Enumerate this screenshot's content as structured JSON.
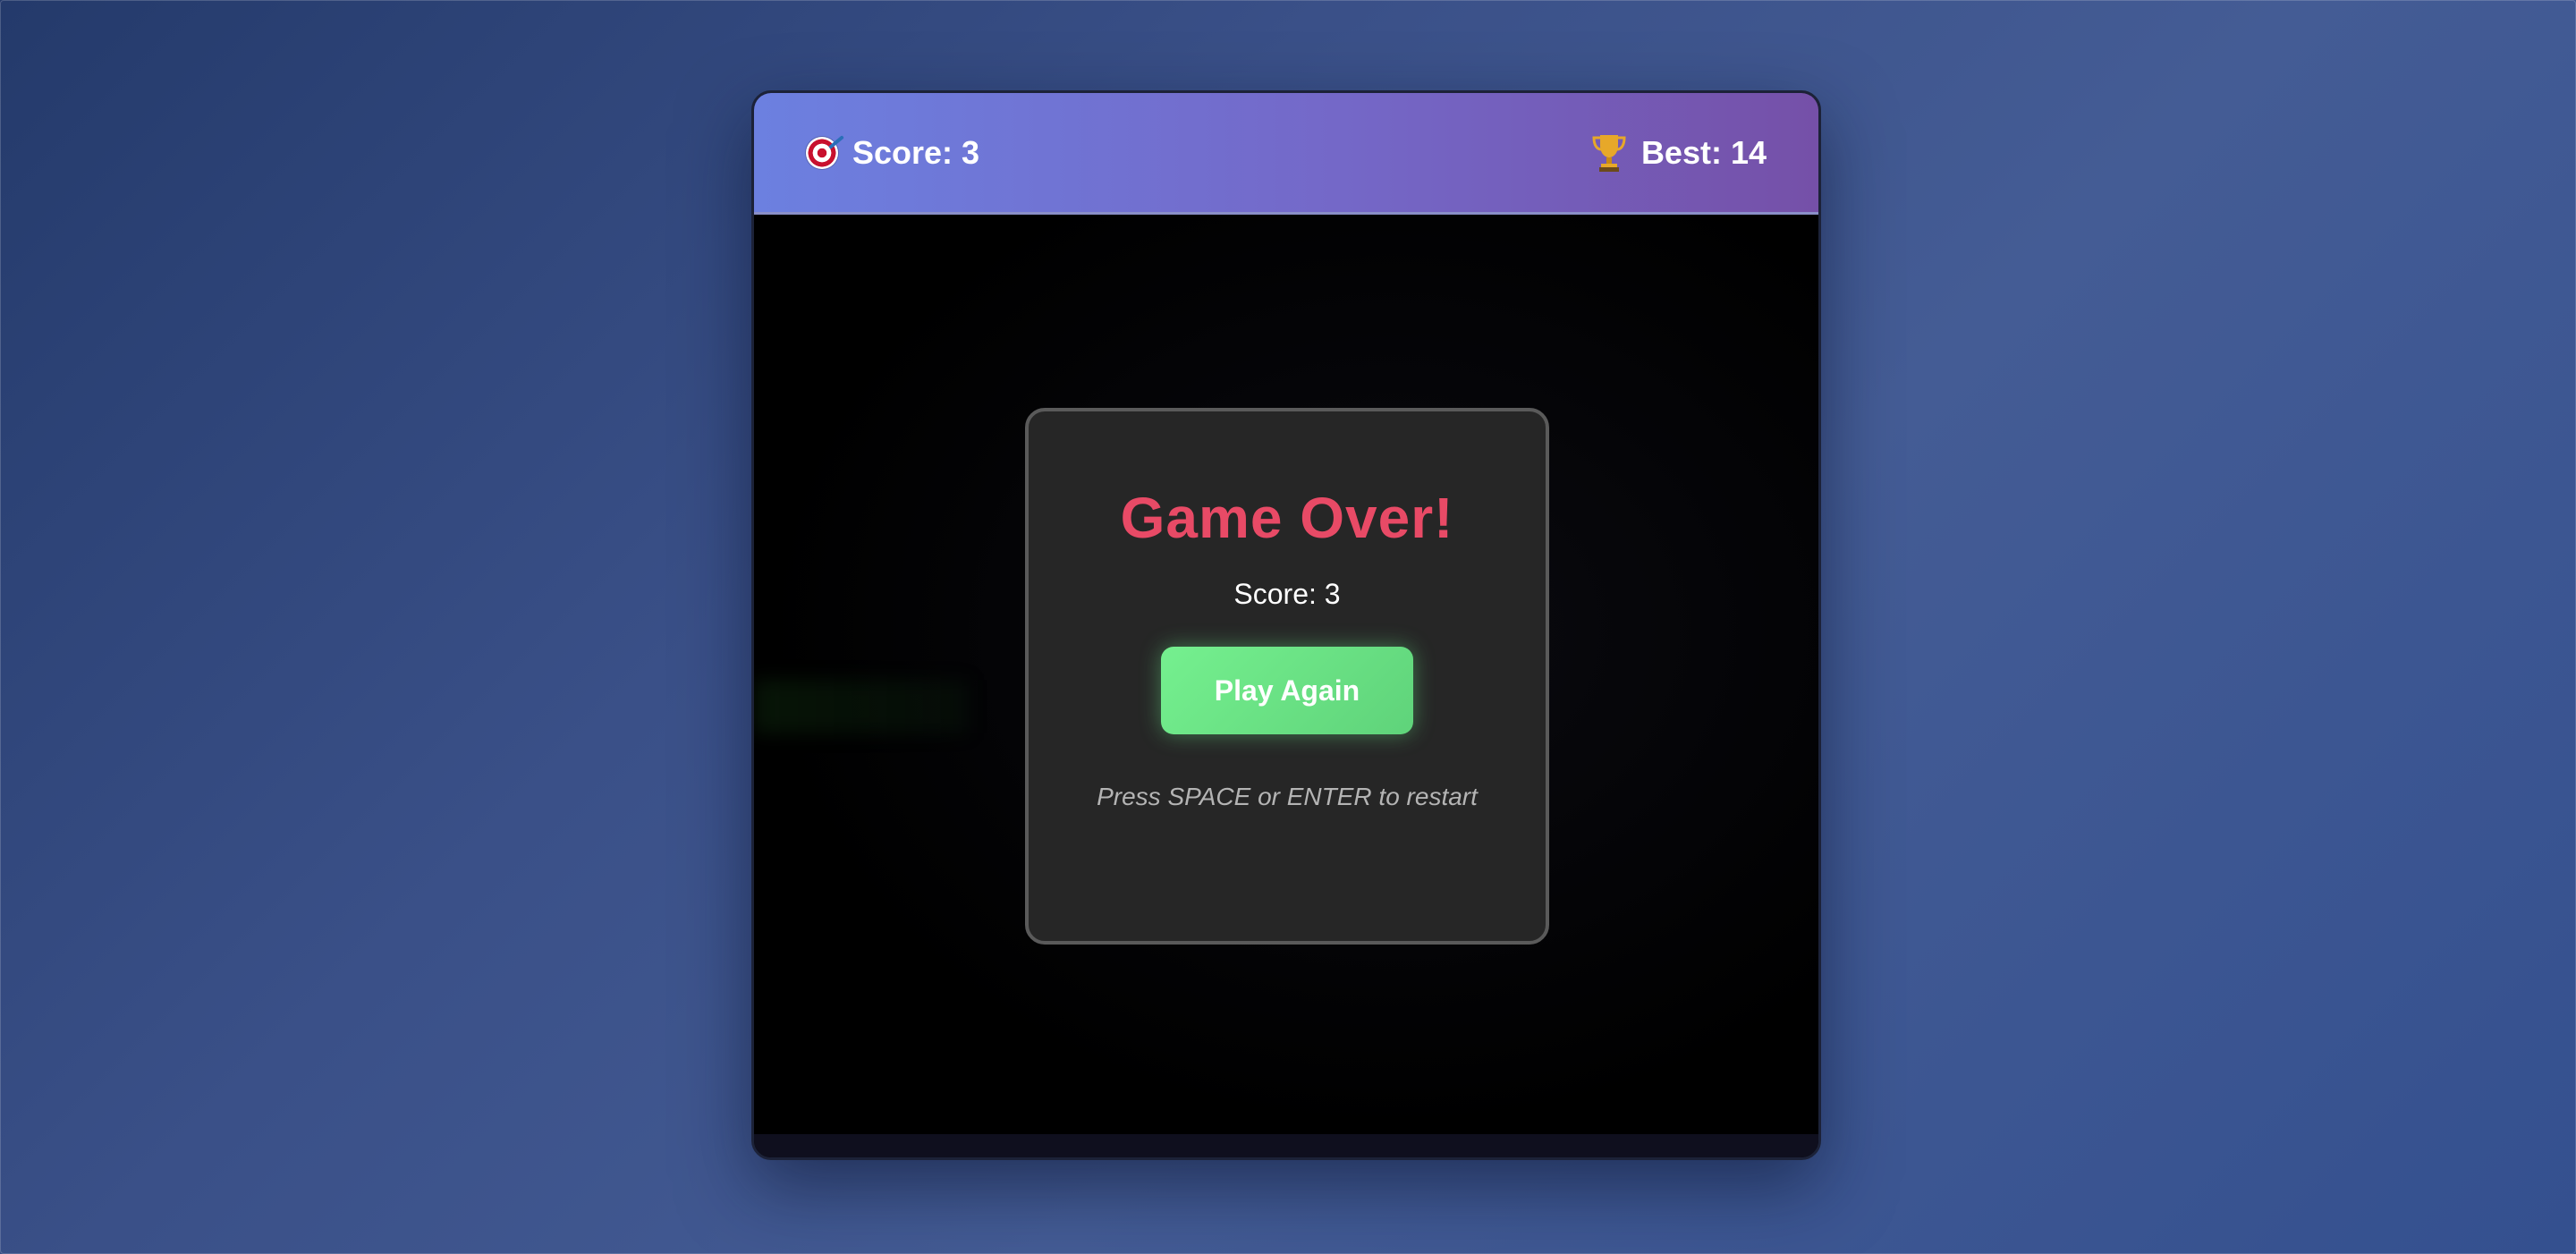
{
  "hud": {
    "score_label": "Score: 3",
    "best_label": "Best: 14",
    "score_icon": "target-icon",
    "best_icon": "trophy-icon"
  },
  "modal": {
    "title": "Game Over!",
    "score_text": "Score: 3",
    "play_again_label": "Play Again",
    "restart_hint": "Press SPACE or ENTER to restart"
  },
  "colors": {
    "title": "#e84a66",
    "button": "#6be184",
    "header_start": "#6c80e0",
    "header_end": "#7550a8"
  }
}
